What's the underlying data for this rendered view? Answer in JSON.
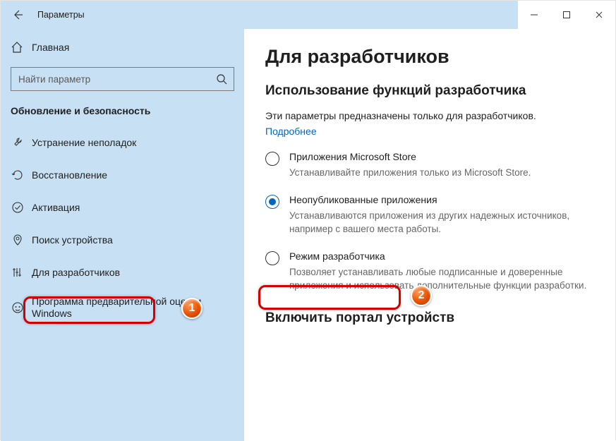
{
  "titlebar": {
    "title": "Параметры"
  },
  "sidebar": {
    "home": "Главная",
    "search_placeholder": "Найти параметр",
    "category": "Обновление и безопасность",
    "items": [
      {
        "label": "Устранение неполадок"
      },
      {
        "label": "Восстановление"
      },
      {
        "label": "Активация"
      },
      {
        "label": "Поиск устройства"
      },
      {
        "label": "Для разработчиков"
      },
      {
        "label": "Программа предварительной оценки Windows"
      }
    ]
  },
  "content": {
    "title": "Для разработчиков",
    "section1": "Использование функций разработчика",
    "intro": "Эти параметры предназначены только для разработчиков.",
    "link": "Подробнее",
    "options": [
      {
        "label": "Приложения Microsoft Store",
        "desc": "Устанавливайте приложения только из Microsoft Store.",
        "selected": false
      },
      {
        "label": "Неопубликованные приложения",
        "desc": "Устанавливаются приложения из других надежных источников, например с вашего места работы.",
        "selected": true
      },
      {
        "label": "Режим разработчика",
        "desc": "Позволяет устанавливать любые подписанные и доверенные приложения и использовать дополнительные функции разработки.",
        "selected": false
      }
    ],
    "section2": "Включить портал устройств"
  },
  "callouts": {
    "one": "1",
    "two": "2"
  }
}
